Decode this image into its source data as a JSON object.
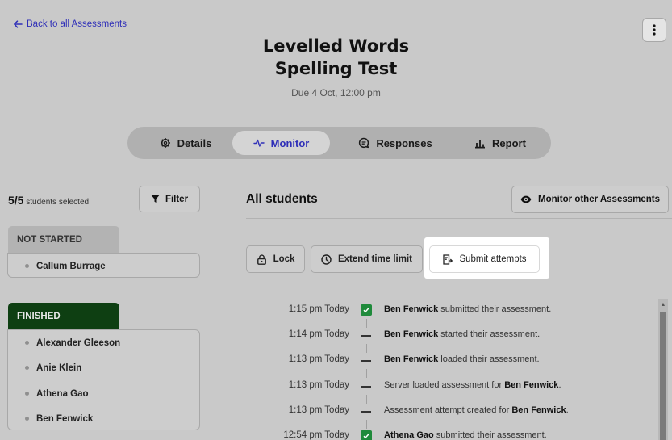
{
  "header": {
    "back_label": "Back to all Assessments",
    "title_line1": "Levelled Words",
    "title_line2": "Spelling Test",
    "due": "Due 4 Oct, 12:00 pm"
  },
  "tabs": [
    {
      "label": "Details",
      "icon": "gear-icon",
      "active": false
    },
    {
      "label": "Monitor",
      "icon": "activity-icon",
      "active": true
    },
    {
      "label": "Responses",
      "icon": "chat-icon",
      "active": false
    },
    {
      "label": "Report",
      "icon": "bar-chart-icon",
      "active": false
    }
  ],
  "students_panel": {
    "selected_count": "5/5",
    "selected_suffix": "students selected",
    "filter_label": "Filter",
    "groups": [
      {
        "heading": "NOT STARTED",
        "students": [
          "Callum Burrage"
        ]
      },
      {
        "heading": "FINISHED",
        "students": [
          "Alexander Gleeson",
          "Anie Klein",
          "Athena Gao",
          "Ben Fenwick"
        ]
      }
    ]
  },
  "main": {
    "heading": "All students",
    "monitor_other_label": "Monitor other Assessments",
    "actions": {
      "lock": "Lock",
      "extend": "Extend time limit",
      "submit": "Submit attempts"
    }
  },
  "timeline": [
    {
      "time": "1:15 pm Today",
      "mark": "check",
      "pre": "",
      "bold": "Ben Fenwick",
      "post": " submitted their assessment."
    },
    {
      "time": "1:14 pm Today",
      "mark": "dash",
      "pre": "",
      "bold": "Ben Fenwick",
      "post": " started their assessment."
    },
    {
      "time": "1:13 pm Today",
      "mark": "dash",
      "pre": "",
      "bold": "Ben Fenwick",
      "post": " loaded their assessment."
    },
    {
      "time": "1:13 pm Today",
      "mark": "dash",
      "pre": "Server loaded assessment for ",
      "bold": "Ben Fenwick",
      "post": "."
    },
    {
      "time": "1:13 pm Today",
      "mark": "dash",
      "pre": "Assessment attempt created for ",
      "bold": "Ben Fenwick",
      "post": "."
    },
    {
      "time": "12:54 pm Today",
      "mark": "check",
      "pre": "",
      "bold": "Athena Gao",
      "post": " submitted their assessment."
    }
  ],
  "colors": {
    "accent": "#2f2fb8",
    "finished_header": "#0e3f12",
    "check_green": "#1f8a3b",
    "background": "#c9c9c9"
  }
}
